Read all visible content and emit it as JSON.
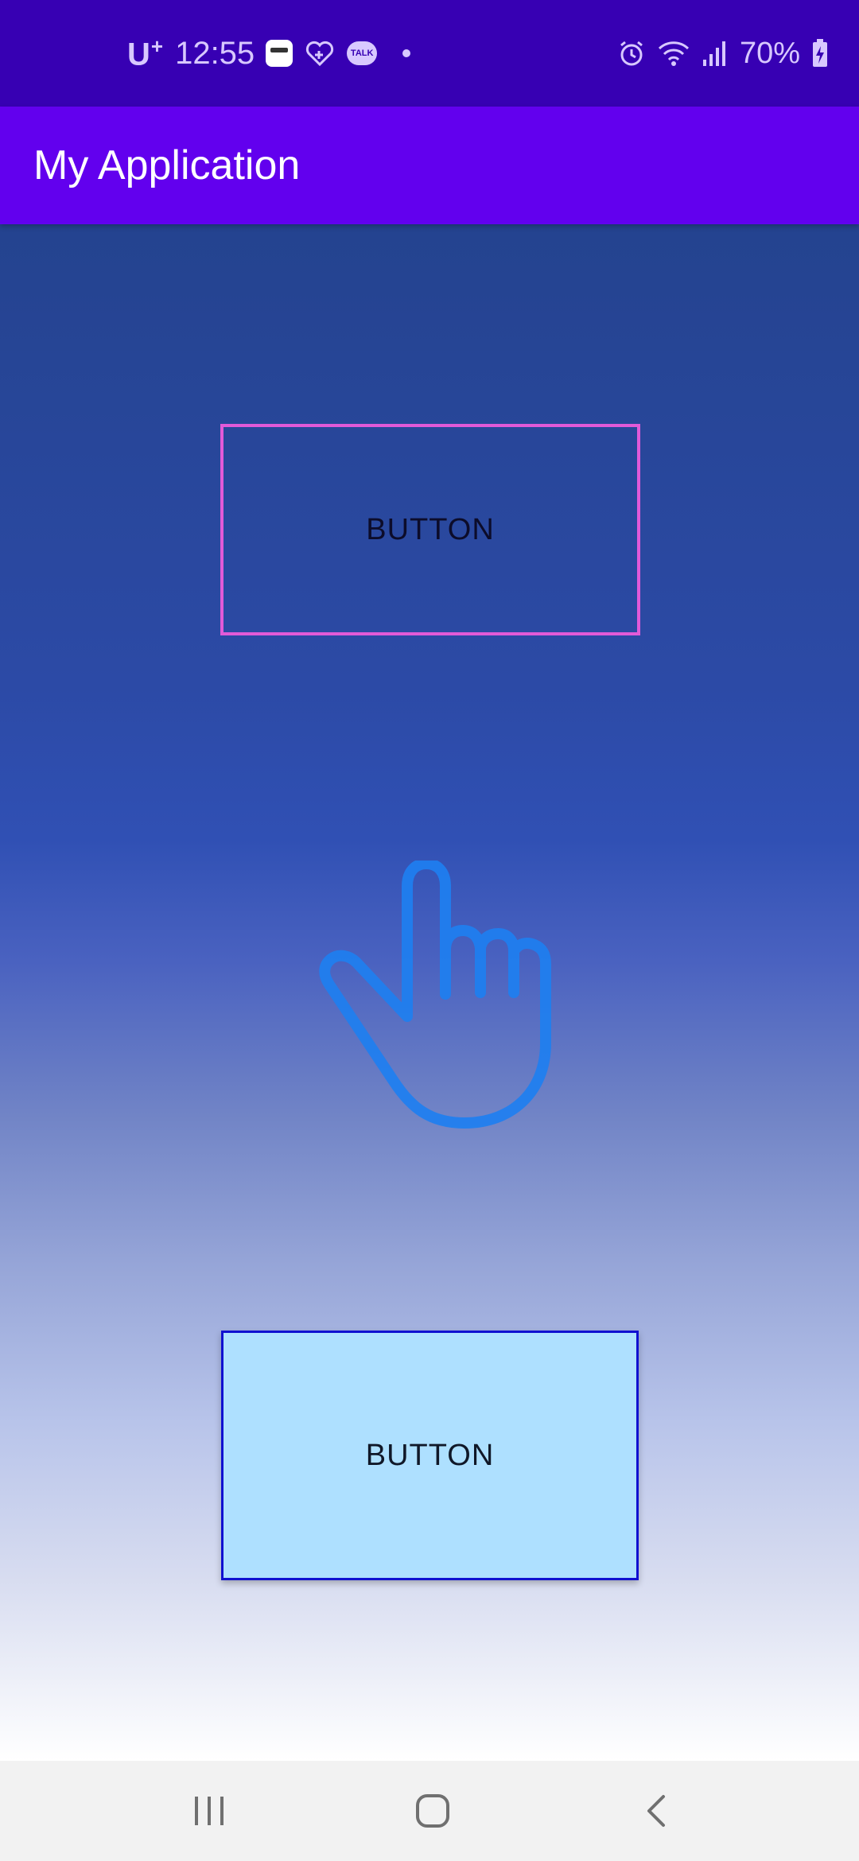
{
  "status_bar": {
    "carrier": "U",
    "carrier_sup": "+",
    "time": "12:55",
    "talk_label": "TALK",
    "battery": "70%"
  },
  "app_bar": {
    "title": "My Application"
  },
  "content": {
    "top_button_label": "BUTTON",
    "bottom_button_label": "BUTTON"
  },
  "colors": {
    "status_bar": "#3700b3",
    "app_bar": "#6200ee",
    "top_button_border": "#e15ad8",
    "bottom_button_fill": "#aee0ff",
    "bottom_button_border": "#1010d0",
    "hand_stroke": "#1e7ff0"
  },
  "icons": {
    "hand": "pointing-hand-icon",
    "nav_recents": "recents-icon",
    "nav_home": "home-icon",
    "nav_back": "back-icon"
  }
}
